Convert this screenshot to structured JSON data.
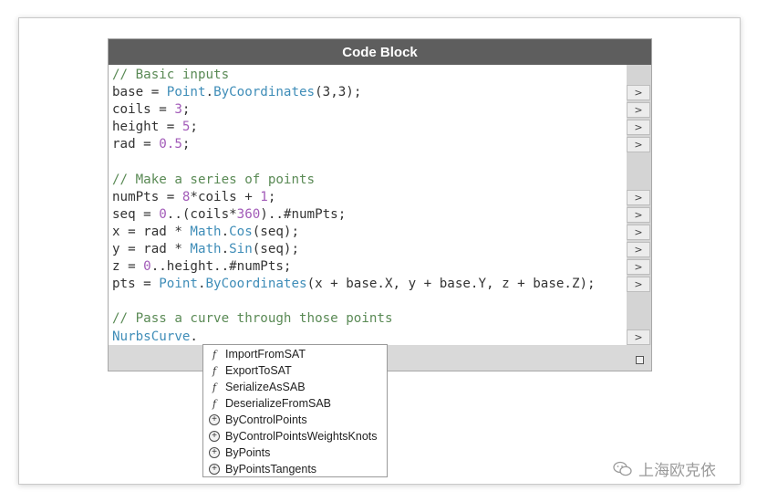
{
  "node": {
    "title": "Code Block"
  },
  "code": {
    "lines": [
      [
        {
          "t": "// Basic inputs",
          "c": "cm"
        }
      ],
      [
        {
          "t": "base = "
        },
        {
          "t": "Point",
          "c": "fn"
        },
        {
          "t": "."
        },
        {
          "t": "ByCoordinates",
          "c": "fn"
        },
        {
          "t": "(3,3);"
        }
      ],
      [
        {
          "t": "coils = "
        },
        {
          "t": "3",
          "c": "num"
        },
        {
          "t": ";"
        }
      ],
      [
        {
          "t": "height = "
        },
        {
          "t": "5",
          "c": "num"
        },
        {
          "t": ";"
        }
      ],
      [
        {
          "t": "rad = "
        },
        {
          "t": "0.5",
          "c": "num"
        },
        {
          "t": ";"
        }
      ],
      [],
      [
        {
          "t": "// Make a series of points",
          "c": "cm"
        }
      ],
      [
        {
          "t": "numPts = "
        },
        {
          "t": "8",
          "c": "num"
        },
        {
          "t": "*coils + "
        },
        {
          "t": "1",
          "c": "num"
        },
        {
          "t": ";"
        }
      ],
      [
        {
          "t": "seq = "
        },
        {
          "t": "0",
          "c": "num"
        },
        {
          "t": "..(coils*"
        },
        {
          "t": "360",
          "c": "num"
        },
        {
          "t": ")..#numPts;"
        }
      ],
      [
        {
          "t": "x = rad * "
        },
        {
          "t": "Math",
          "c": "fn"
        },
        {
          "t": "."
        },
        {
          "t": "Cos",
          "c": "fn"
        },
        {
          "t": "(seq);"
        }
      ],
      [
        {
          "t": "y = rad * "
        },
        {
          "t": "Math",
          "c": "fn"
        },
        {
          "t": "."
        },
        {
          "t": "Sin",
          "c": "fn"
        },
        {
          "t": "(seq);"
        }
      ],
      [
        {
          "t": "z = "
        },
        {
          "t": "0",
          "c": "num"
        },
        {
          "t": "..height..#numPts;"
        }
      ],
      [
        {
          "t": "pts = "
        },
        {
          "t": "Point",
          "c": "fn"
        },
        {
          "t": "."
        },
        {
          "t": "ByCoordinates",
          "c": "fn"
        },
        {
          "t": "(x + base.X, y + base.Y, z + base.Z);"
        }
      ],
      [],
      [
        {
          "t": "// Pass a curve through those points",
          "c": "cm"
        }
      ],
      [
        {
          "t": "NurbsCurve",
          "c": "fn"
        },
        {
          "t": "."
        }
      ]
    ]
  },
  "ports": {
    "glyph": ">",
    "lines": [
      1,
      2,
      3,
      4,
      7,
      8,
      9,
      10,
      11,
      12,
      15
    ]
  },
  "autocomplete": {
    "items": [
      {
        "label": "ImportFromSAT",
        "kind": "method",
        "icon_name": "function-icon"
      },
      {
        "label": "ExportToSAT",
        "kind": "method",
        "icon_name": "function-icon"
      },
      {
        "label": "SerializeAsSAB",
        "kind": "method",
        "icon_name": "function-icon"
      },
      {
        "label": "DeserializeFromSAB",
        "kind": "method",
        "icon_name": "function-icon"
      },
      {
        "label": "ByControlPoints",
        "kind": "constructor",
        "icon_name": "constructor-icon"
      },
      {
        "label": "ByControlPointsWeightsKnots",
        "kind": "constructor",
        "icon_name": "constructor-icon"
      },
      {
        "label": "ByPoints",
        "kind": "constructor",
        "icon_name": "constructor-icon"
      },
      {
        "label": "ByPointsTangents",
        "kind": "constructor",
        "icon_name": "constructor-icon"
      }
    ]
  },
  "watermark": {
    "text": "上海欧克依",
    "icon_name": "wechat-icon"
  },
  "colors": {
    "comment": "#5a8a55",
    "class_method": "#3f8db8",
    "number": "#a25bb8",
    "header_bg": "#5e5e5e"
  }
}
